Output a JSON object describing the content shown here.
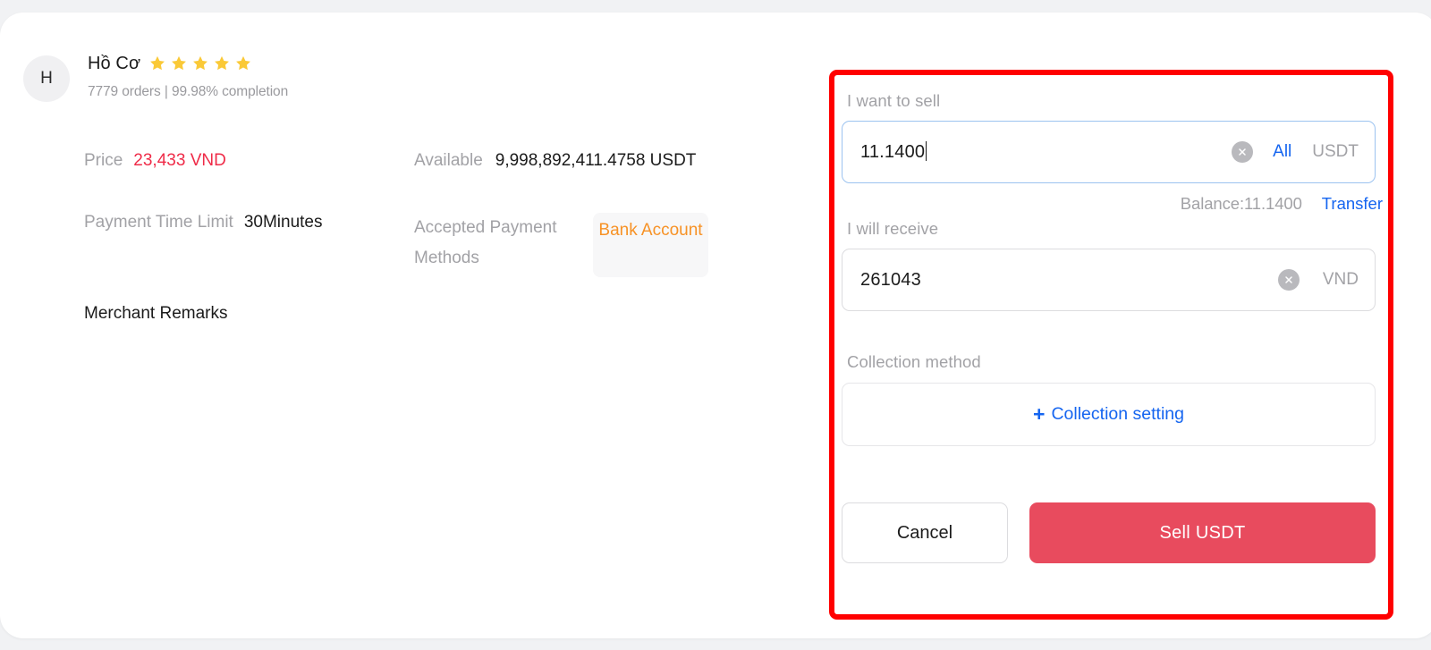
{
  "merchant": {
    "avatar_initial": "H",
    "name": "Hồ Cơ",
    "rating_stars": 5,
    "meta": "7779 orders | 99.98% completion",
    "star_color": "#fac937"
  },
  "details": {
    "price_label": "Price",
    "price_value": "23,433 VND",
    "price_color": "#ef2b48",
    "available_label": "Available",
    "available_value": "9,998,892,411.4758 USDT",
    "payment_time_label": "Payment Time Limit",
    "payment_time_value": "30Minutes",
    "accepted_methods_label": "Accepted Payment Methods",
    "accepted_method_chip": "Bank Account",
    "chip_color": "#f79226",
    "merchant_remarks_label": "Merchant Remarks"
  },
  "sell_panel": {
    "sell_label": "I want to sell",
    "sell_input_value": "11.1400",
    "sell_all_label": "All",
    "sell_unit": "USDT",
    "balance_text": "Balance:11.1400",
    "transfer_label": "Transfer",
    "receive_label": "I will receive",
    "receive_input_value": "261043",
    "receive_unit": "VND",
    "collection_label": "Collection method",
    "collection_setting_label": "Collection setting",
    "collection_plus": "+",
    "cancel_label": "Cancel",
    "sell_button_label": "Sell USDT",
    "sell_button_color": "#e84b5e",
    "link_color": "#1565f0",
    "annotation_color": "#ff0000"
  }
}
